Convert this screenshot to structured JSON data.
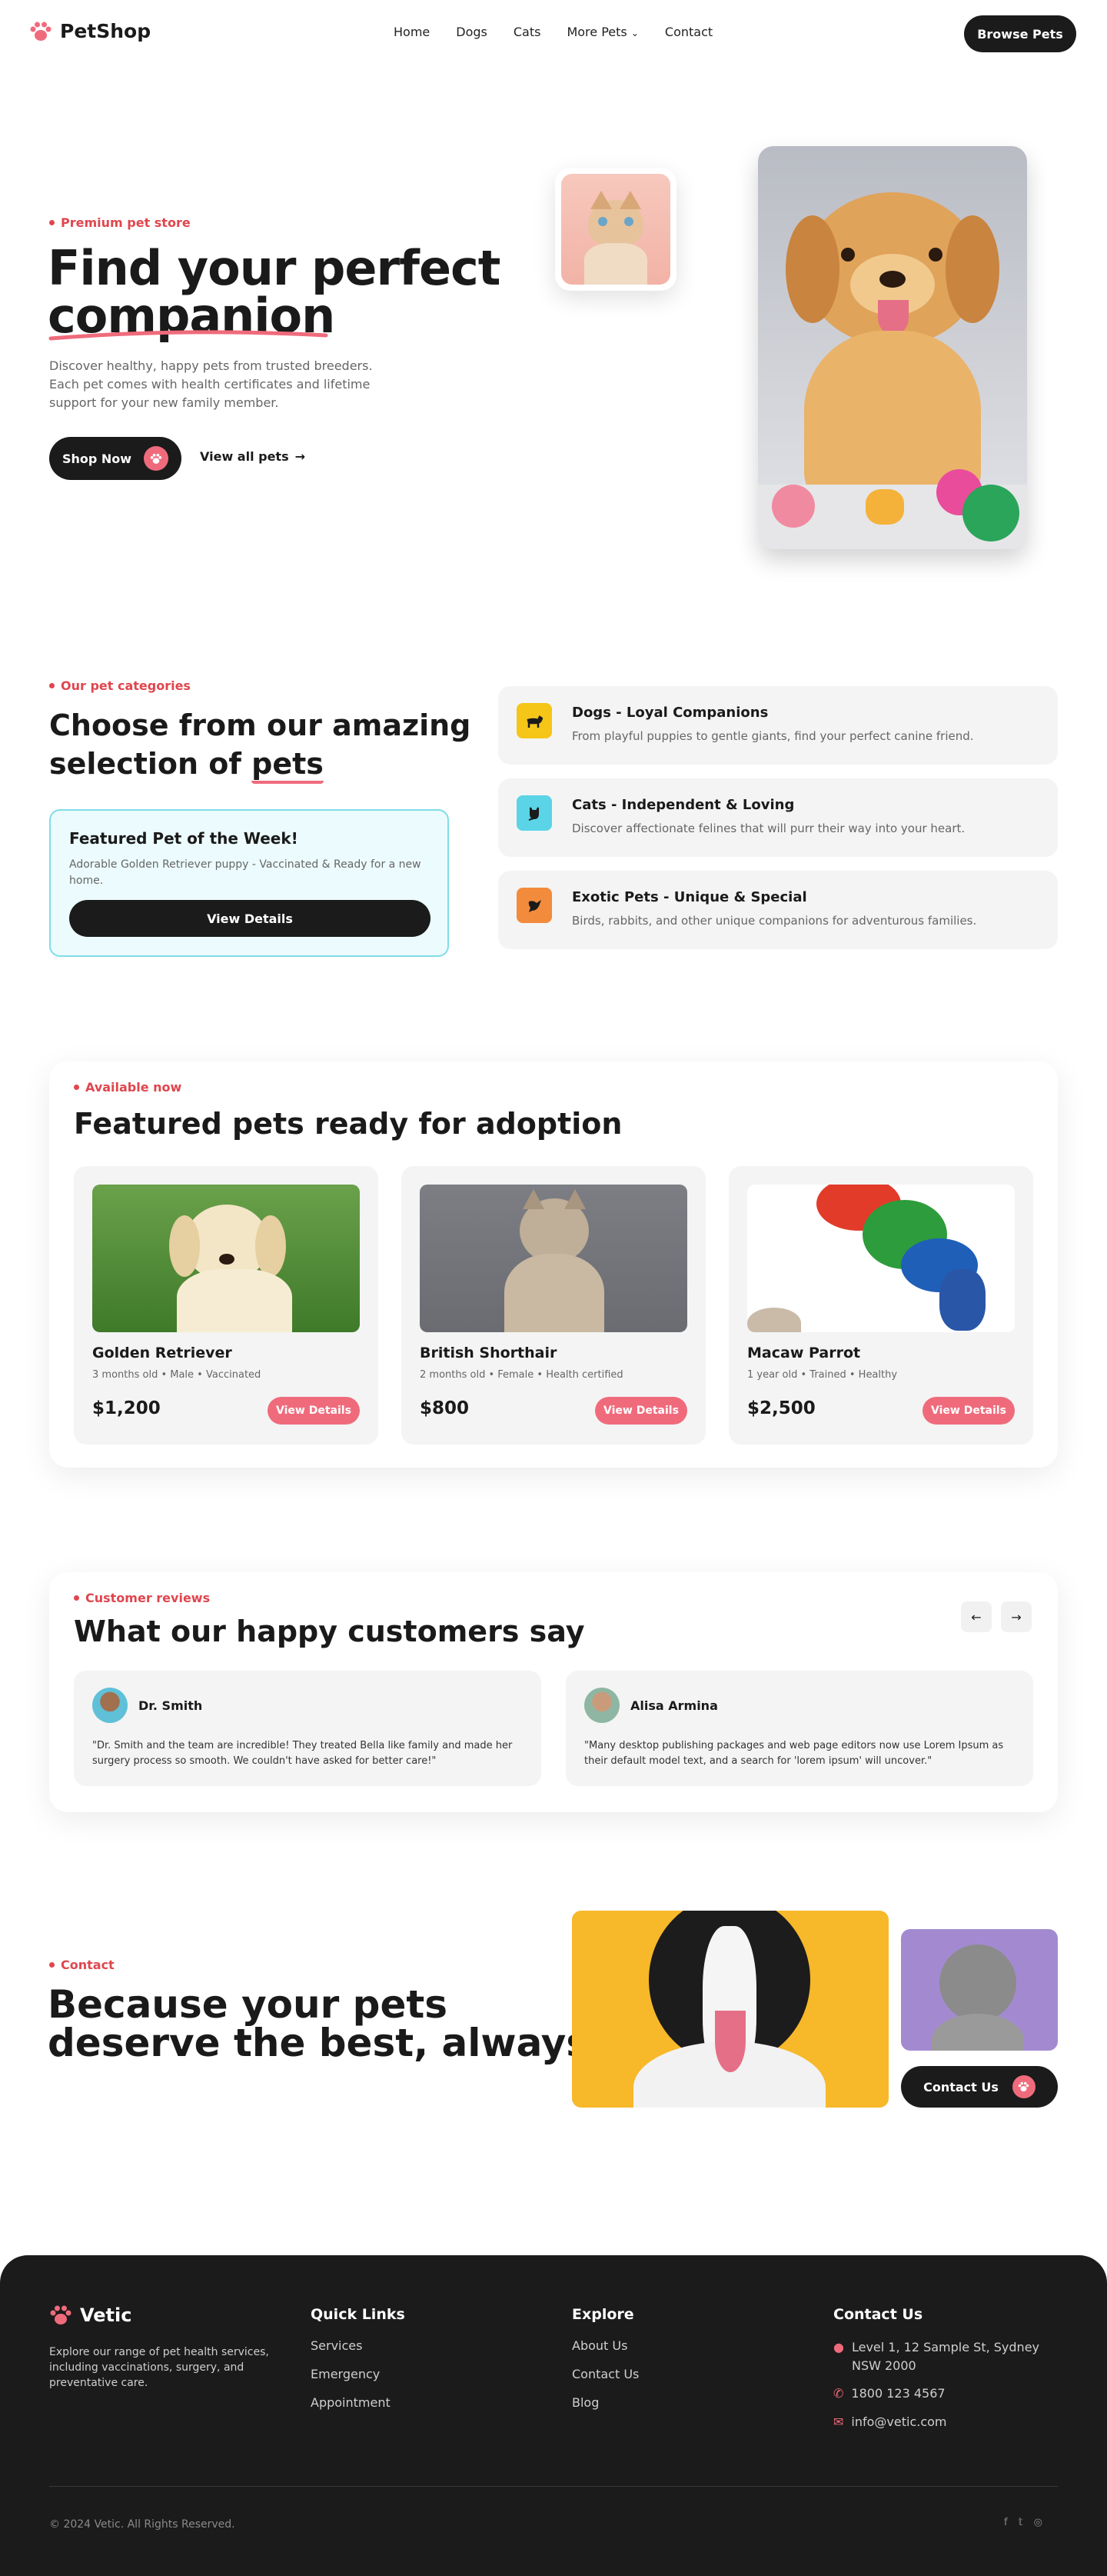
{
  "brand": {
    "name": "PetShop",
    "accent": "#e0464e",
    "pink": "#ef6b7c",
    "dark": "#1b1b1b"
  },
  "nav": {
    "items": [
      "Home",
      "Dogs",
      "Cats"
    ],
    "more": "More Pets",
    "contact": "Contact",
    "cta": "Browse Pets"
  },
  "hero": {
    "eyebrow": "Premium pet store",
    "title_line1": "Find your perfect",
    "title_line2": "companion",
    "desc": "Discover healthy, happy pets from trusted breeders. Each pet comes with health certificates and lifetime support for your new family member.",
    "shop_btn": "Shop Now",
    "view_all": "View all pets"
  },
  "categories": {
    "eyebrow": "Our pet categories",
    "title_line1": "Choose from our amazing",
    "title_line2a": "selection of ",
    "title_line2b": "pets",
    "featured": {
      "title": "Featured Pet of the Week!",
      "desc": "Adorable Golden Retriever puppy - Vaccinated & Ready for a new home.",
      "btn": "View Details"
    },
    "items": [
      {
        "title": "Dogs - Loyal Companions",
        "desc": "From playful puppies to gentle giants, find your perfect canine friend.",
        "icon": "dog-icon",
        "color": "#f5c518"
      },
      {
        "title": "Cats - Independent & Loving",
        "desc": "Discover affectionate felines that will purr their way into your heart.",
        "icon": "cat-icon",
        "color": "#5ad4e6"
      },
      {
        "title": "Exotic Pets - Unique & Special",
        "desc": "Birds, rabbits, and other unique companions for adventurous families.",
        "icon": "bird-icon",
        "color": "#f28b3c"
      }
    ]
  },
  "featured": {
    "eyebrow": "Available now",
    "title": "Featured pets ready for adoption",
    "pets": [
      {
        "name": "Golden Retriever",
        "meta": "3 months old • Male • Vaccinated",
        "price": "$1,200",
        "btn": "View Details"
      },
      {
        "name": "British Shorthair",
        "meta": "2 months old • Female • Health certified",
        "price": "$800",
        "btn": "View Details"
      },
      {
        "name": "Macaw Parrot",
        "meta": "1 year old • Trained • Healthy",
        "price": "$2,500",
        "btn": "View Details"
      }
    ]
  },
  "reviews": {
    "eyebrow": "Customer reviews",
    "title": "What our happy customers say",
    "items": [
      {
        "name": "Dr. Smith",
        "text": "\"Dr. Smith and the team are incredible! They treated Bella like family and made her surgery process so smooth. We couldn't have asked for better care!\""
      },
      {
        "name": "Alisa Armina",
        "text": "\"Many desktop publishing packages and web page editors now use Lorem Ipsum as their default model text, and a search for 'lorem ipsum' will uncover.\""
      }
    ]
  },
  "contact": {
    "eyebrow": "Contact",
    "title_line1": "Because your pets",
    "title_line2": "deserve the best, always",
    "btn": "Contact Us"
  },
  "footer": {
    "brand": "Vetic",
    "about": "Explore our range of pet health services, including vaccinations, surgery, and preventative care.",
    "quick_title": "Quick Links",
    "quick": [
      "Services",
      "Emergency",
      "Appointment"
    ],
    "explore_title": "Explore",
    "explore": [
      "About Us",
      "Contact Us",
      "Blog"
    ],
    "contact_title": "Contact Us",
    "address": "Level 1, 12 Sample St, Sydney NSW 2000",
    "phone": "1800 123 4567",
    "email": "info@vetic.com",
    "copyright": "© 2024 Vetic. All Rights Reserved."
  }
}
